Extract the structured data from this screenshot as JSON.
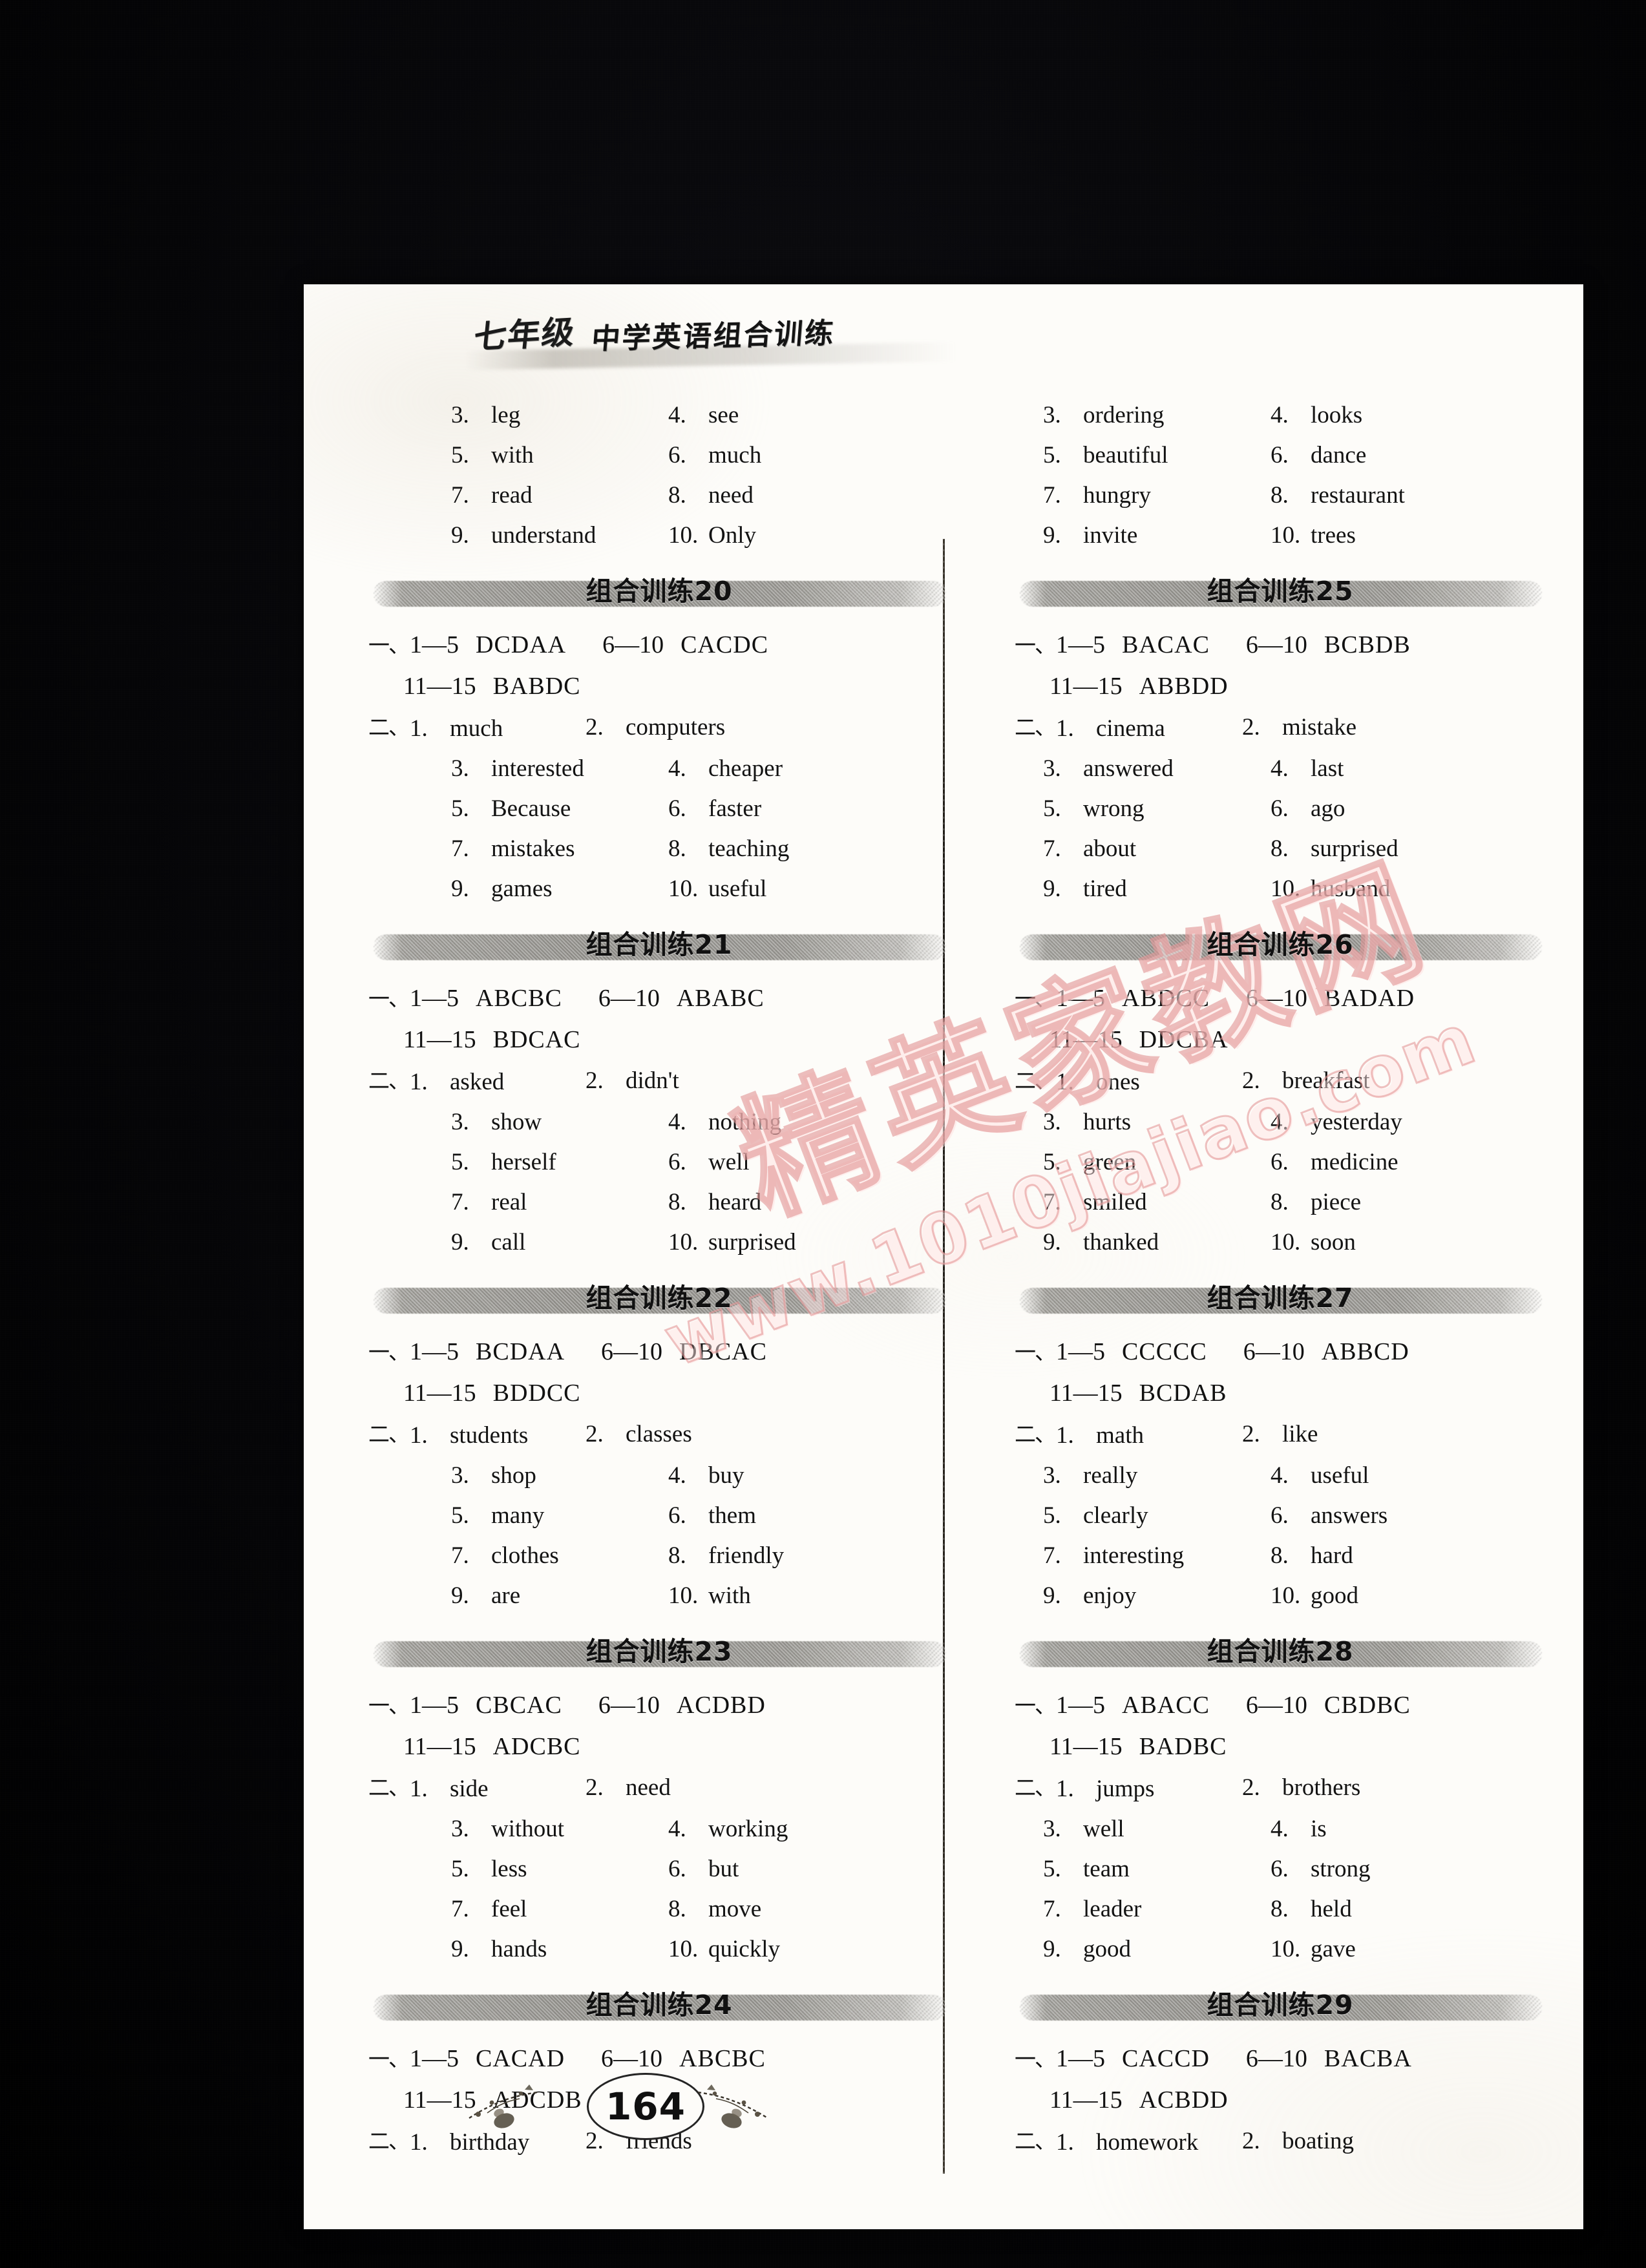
{
  "running_head": {
    "grade": "七年级",
    "title": "中学英语组合训练"
  },
  "page_number": "164",
  "watermark": {
    "cn": "精英家教网",
    "url": "www.1010jiajiao.com"
  },
  "labels": {
    "mark_one": "一、",
    "mark_two": "二、",
    "range1": "1—5",
    "range2": "6—10",
    "range3": "11—15"
  },
  "left_column": {
    "continued_words": [
      {
        "n1": "3.",
        "w1": "leg",
        "n2": "4.",
        "w2": "see"
      },
      {
        "n1": "5.",
        "w1": "with",
        "n2": "6.",
        "w2": "much"
      },
      {
        "n1": "7.",
        "w1": "read",
        "n2": "8.",
        "w2": "need"
      },
      {
        "n1": "9.",
        "w1": "understand",
        "n2": "10.",
        "w2": "Only"
      }
    ],
    "sections": [
      {
        "title": "组合训练20",
        "mc": {
          "a1": "DCDAA",
          "a2": "CACDC",
          "a3": "BABDC"
        },
        "fill": [
          {
            "n1": "1.",
            "w1": "much",
            "n2": "2.",
            "w2": "computers"
          },
          {
            "n1": "3.",
            "w1": "interested",
            "n2": "4.",
            "w2": "cheaper"
          },
          {
            "n1": "5.",
            "w1": "Because",
            "n2": "6.",
            "w2": "faster"
          },
          {
            "n1": "7.",
            "w1": "mistakes",
            "n2": "8.",
            "w2": "teaching"
          },
          {
            "n1": "9.",
            "w1": "games",
            "n2": "10.",
            "w2": "useful"
          }
        ]
      },
      {
        "title": "组合训练21",
        "mc": {
          "a1": "ABCBC",
          "a2": "ABABC",
          "a3": "BDCAC"
        },
        "fill": [
          {
            "n1": "1.",
            "w1": "asked",
            "n2": "2.",
            "w2": "didn't"
          },
          {
            "n1": "3.",
            "w1": "show",
            "n2": "4.",
            "w2": "nothing"
          },
          {
            "n1": "5.",
            "w1": "herself",
            "n2": "6.",
            "w2": "well"
          },
          {
            "n1": "7.",
            "w1": "real",
            "n2": "8.",
            "w2": "heard"
          },
          {
            "n1": "9.",
            "w1": "call",
            "n2": "10.",
            "w2": "surprised"
          }
        ]
      },
      {
        "title": "组合训练22",
        "mc": {
          "a1": "BCDAA",
          "a2": "DBCAC",
          "a3": "BDDCC"
        },
        "fill": [
          {
            "n1": "1.",
            "w1": "students",
            "n2": "2.",
            "w2": "classes"
          },
          {
            "n1": "3.",
            "w1": "shop",
            "n2": "4.",
            "w2": "buy"
          },
          {
            "n1": "5.",
            "w1": "many",
            "n2": "6.",
            "w2": "them"
          },
          {
            "n1": "7.",
            "w1": "clothes",
            "n2": "8.",
            "w2": "friendly"
          },
          {
            "n1": "9.",
            "w1": "are",
            "n2": "10.",
            "w2": "with"
          }
        ]
      },
      {
        "title": "组合训练23",
        "mc": {
          "a1": "CBCAC",
          "a2": "ACDBD",
          "a3": "ADCBC"
        },
        "fill": [
          {
            "n1": "1.",
            "w1": "side",
            "n2": "2.",
            "w2": "need"
          },
          {
            "n1": "3.",
            "w1": "without",
            "n2": "4.",
            "w2": "working"
          },
          {
            "n1": "5.",
            "w1": "less",
            "n2": "6.",
            "w2": "but"
          },
          {
            "n1": "7.",
            "w1": "feel",
            "n2": "8.",
            "w2": "move"
          },
          {
            "n1": "9.",
            "w1": "hands",
            "n2": "10.",
            "w2": "quickly"
          }
        ]
      },
      {
        "title": "组合训练24",
        "mc": {
          "a1": "CACAD",
          "a2": "ABCBC",
          "a3": "ADCDB"
        },
        "fill": [
          {
            "n1": "1.",
            "w1": "birthday",
            "n2": "2.",
            "w2": "friends"
          }
        ]
      }
    ]
  },
  "right_column": {
    "continued_words": [
      {
        "n1": "3.",
        "w1": "ordering",
        "n2": "4.",
        "w2": "looks"
      },
      {
        "n1": "5.",
        "w1": "beautiful",
        "n2": "6.",
        "w2": "dance"
      },
      {
        "n1": "7.",
        "w1": "hungry",
        "n2": "8.",
        "w2": "restaurant"
      },
      {
        "n1": "9.",
        "w1": "invite",
        "n2": "10.",
        "w2": "trees"
      }
    ],
    "sections": [
      {
        "title": "组合训练25",
        "mc": {
          "a1": "BACAC",
          "a2": "BCBDB",
          "a3": "ABBDD"
        },
        "fill": [
          {
            "n1": "1.",
            "w1": "cinema",
            "n2": "2.",
            "w2": "mistake"
          },
          {
            "n1": "3.",
            "w1": "answered",
            "n2": "4.",
            "w2": "last"
          },
          {
            "n1": "5.",
            "w1": "wrong",
            "n2": "6.",
            "w2": "ago"
          },
          {
            "n1": "7.",
            "w1": "about",
            "n2": "8.",
            "w2": "surprised"
          },
          {
            "n1": "9.",
            "w1": "tired",
            "n2": "10.",
            "w2": "husband"
          }
        ]
      },
      {
        "title": "组合训练26",
        "mc": {
          "a1": "ABDCC",
          "a2": "BADAD",
          "a3": "DDCBA"
        },
        "fill": [
          {
            "n1": "1.",
            "w1": "ones",
            "n2": "2.",
            "w2": "breakfast"
          },
          {
            "n1": "3.",
            "w1": "hurts",
            "n2": "4.",
            "w2": "yesterday"
          },
          {
            "n1": "5.",
            "w1": "green",
            "n2": "6.",
            "w2": "medicine"
          },
          {
            "n1": "7.",
            "w1": "smiled",
            "n2": "8.",
            "w2": "piece"
          },
          {
            "n1": "9.",
            "w1": "thanked",
            "n2": "10.",
            "w2": "soon"
          }
        ]
      },
      {
        "title": "组合训练27",
        "mc": {
          "a1": "CCCCC",
          "a2": "ABBCD",
          "a3": "BCDAB"
        },
        "fill": [
          {
            "n1": "1.",
            "w1": "math",
            "n2": "2.",
            "w2": "like"
          },
          {
            "n1": "3.",
            "w1": "really",
            "n2": "4.",
            "w2": "useful"
          },
          {
            "n1": "5.",
            "w1": "clearly",
            "n2": "6.",
            "w2": "answers"
          },
          {
            "n1": "7.",
            "w1": "interesting",
            "n2": "8.",
            "w2": "hard"
          },
          {
            "n1": "9.",
            "w1": "enjoy",
            "n2": "10.",
            "w2": "good"
          }
        ]
      },
      {
        "title": "组合训练28",
        "mc": {
          "a1": "ABACC",
          "a2": "CBDBC",
          "a3": "BADBC"
        },
        "fill": [
          {
            "n1": "1.",
            "w1": "jumps",
            "n2": "2.",
            "w2": "brothers"
          },
          {
            "n1": "3.",
            "w1": "well",
            "n2": "4.",
            "w2": "is"
          },
          {
            "n1": "5.",
            "w1": "team",
            "n2": "6.",
            "w2": "strong"
          },
          {
            "n1": "7.",
            "w1": "leader",
            "n2": "8.",
            "w2": "held"
          },
          {
            "n1": "9.",
            "w1": "good",
            "n2": "10.",
            "w2": "gave"
          }
        ]
      },
      {
        "title": "组合训练29",
        "mc": {
          "a1": "CACCD",
          "a2": "BACBA",
          "a3": "ACBDD"
        },
        "fill": [
          {
            "n1": "1.",
            "w1": "homework",
            "n2": "2.",
            "w2": "boating"
          }
        ]
      }
    ]
  }
}
